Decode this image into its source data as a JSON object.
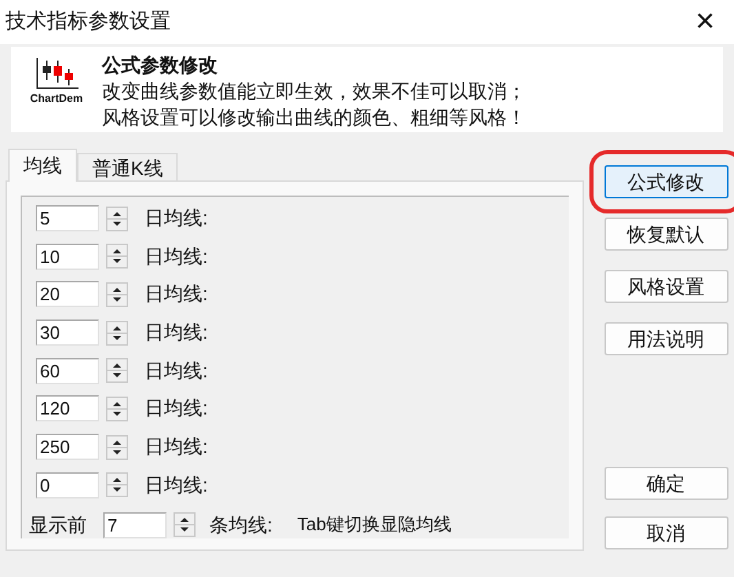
{
  "window": {
    "title": "技术指标参数设置",
    "close": "×"
  },
  "header": {
    "logo_text": "ChartDem",
    "title": "公式参数修改",
    "lines": [
      "改变曲线参数值能立即生效，效果不佳可以取消；",
      "风格设置可以修改输出曲线的颜色、粗细等风格！"
    ]
  },
  "tabs": [
    {
      "label": "均线",
      "selected": true
    },
    {
      "label": "普通K线",
      "selected": false
    }
  ],
  "ma_rows": [
    {
      "value": "5",
      "label": "日均线:"
    },
    {
      "value": "10",
      "label": "日均线:"
    },
    {
      "value": "20",
      "label": "日均线:"
    },
    {
      "value": "30",
      "label": "日均线:"
    },
    {
      "value": "60",
      "label": "日均线:"
    },
    {
      "value": "120",
      "label": "日均线:"
    },
    {
      "value": "250",
      "label": "日均线:"
    },
    {
      "value": "0",
      "label": "日均线:"
    }
  ],
  "show_row": {
    "prefix": "显示前",
    "value": "7",
    "suffix": "条均线:",
    "hint": "Tab键切换显隐均线"
  },
  "side_buttons": [
    {
      "label": "公式修改",
      "highlighted": true
    },
    {
      "label": "恢复默认",
      "highlighted": false
    },
    {
      "label": "风格设置",
      "highlighted": false
    },
    {
      "label": "用法说明",
      "highlighted": false
    }
  ],
  "dialog_buttons": [
    "确定",
    "取消"
  ]
}
